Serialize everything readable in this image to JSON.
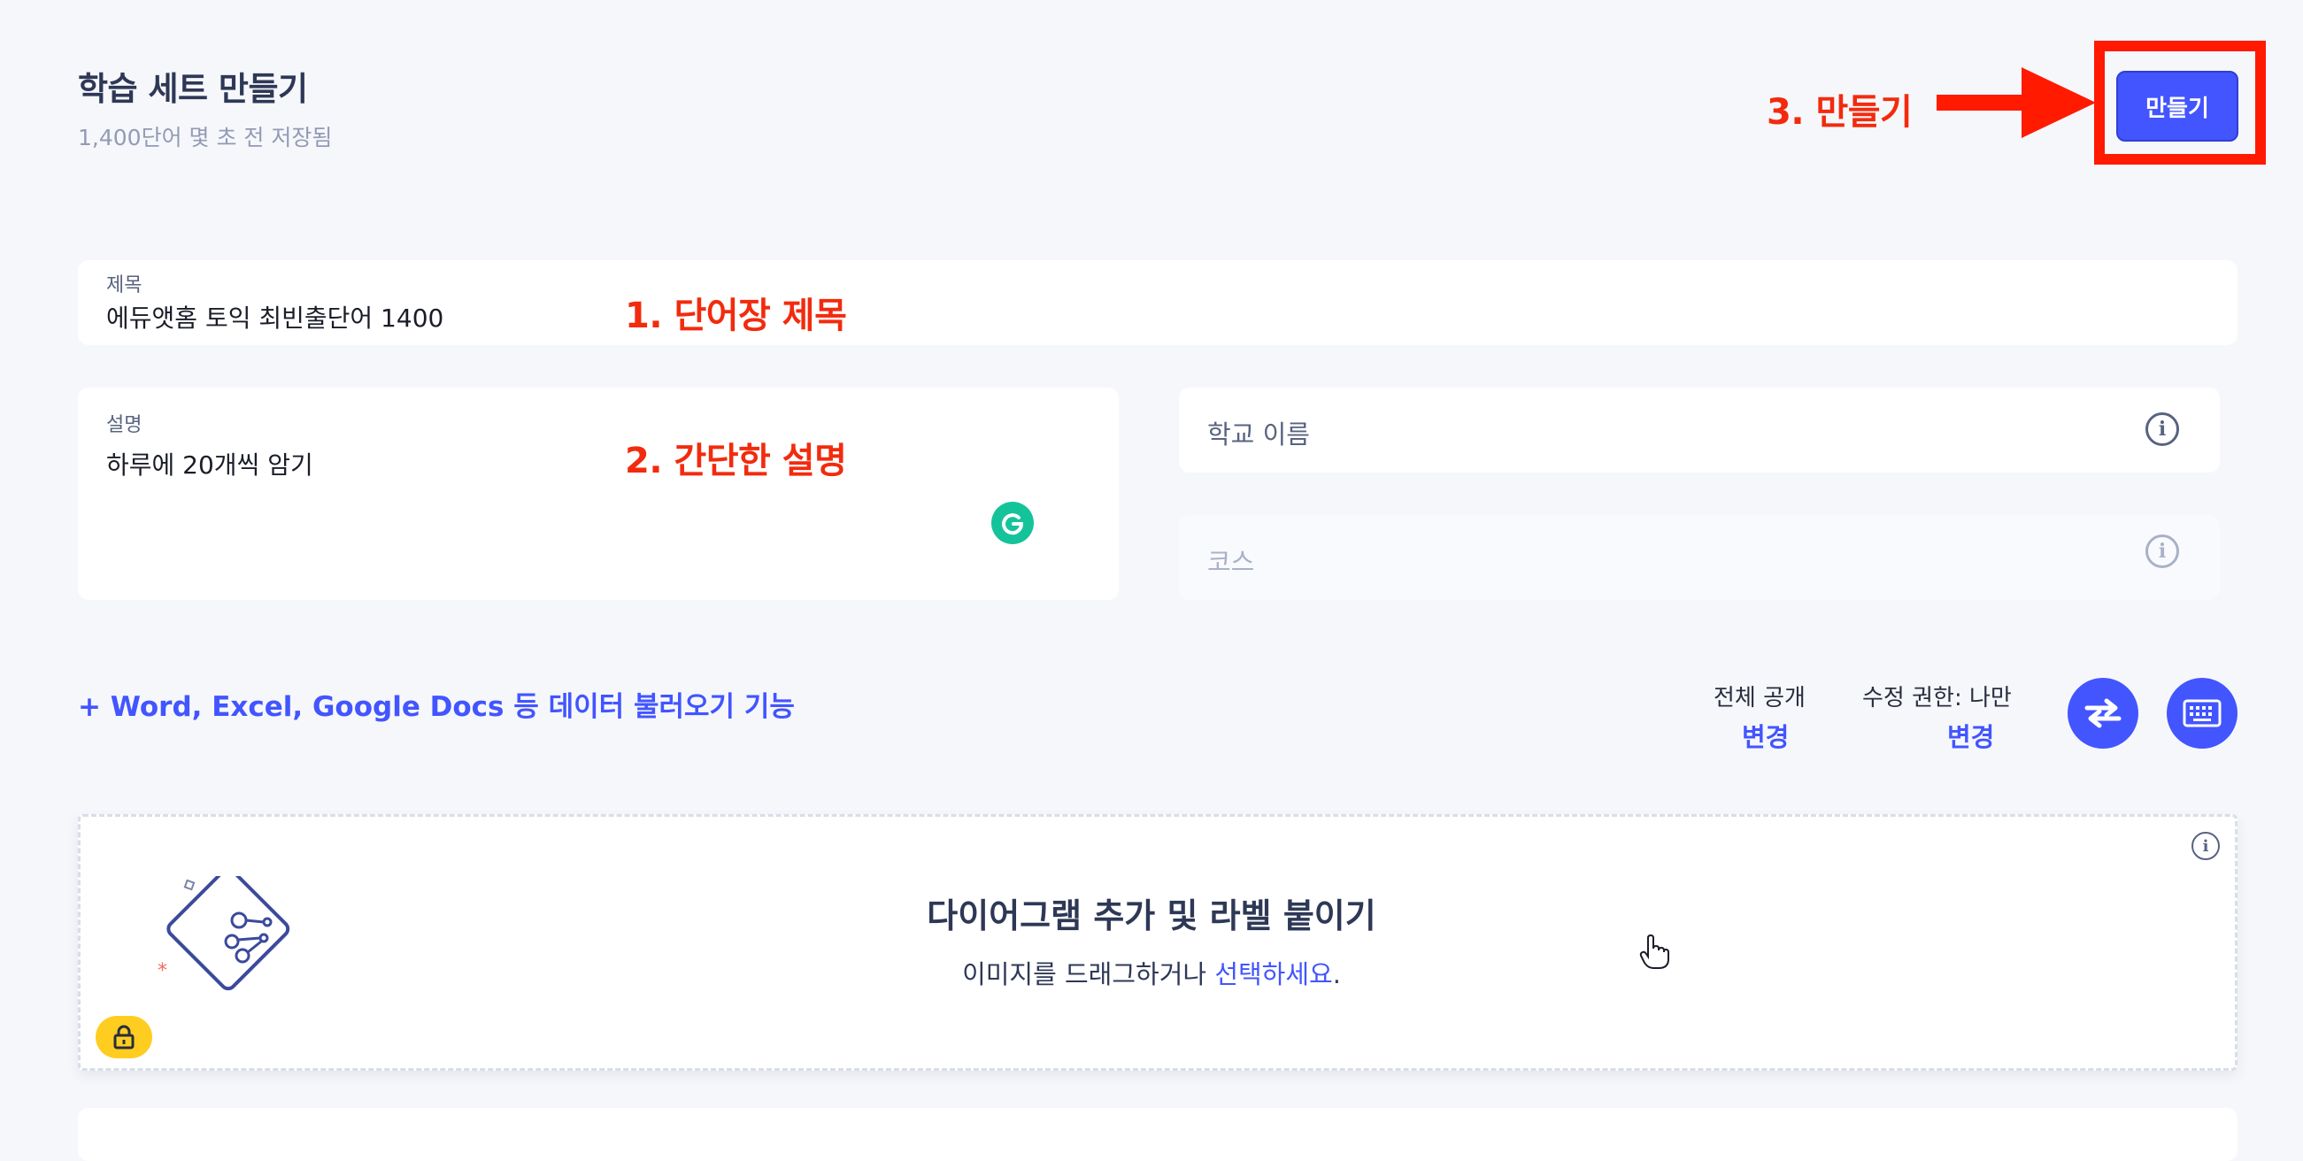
{
  "header": {
    "title": "학습 세트 만들기",
    "subtitle": "1,400단어 몇 초 전 저장됨",
    "create_label": "만들기"
  },
  "annotations": {
    "step1": "1. 단어장 제목",
    "step2": "2. 간단한 설명",
    "step3": "3. 만들기",
    "color": "#f22b0e"
  },
  "form": {
    "title_label": "제목",
    "title_value": "에듀앳홈 토익 최빈출단어 1400",
    "description_label": "설명",
    "description_value": "하루에 20개씩 암기",
    "school_placeholder": "학교 이름",
    "course_placeholder": "코스"
  },
  "import_link": "+ Word, Excel, Google Docs 등 데이터 불러오기 기능",
  "visibility": {
    "public_label": "전체 공개",
    "public_action": "변경",
    "edit_label": "수정 권한: 나만",
    "edit_action": "변경"
  },
  "icons": {
    "swap": "swap-arrows-icon",
    "keyboard": "keyboard-icon",
    "info": "info-icon",
    "lock": "lock-icon",
    "grammarly": "grammarly-icon",
    "diagram": "diagram-illustration-icon"
  },
  "diagram": {
    "title": "다이어그램 추가 및 라벨 붙이기",
    "subtitle_prefix": "이미지를 드래그하거나 ",
    "subtitle_link": "선택하세요",
    "subtitle_suffix": "."
  },
  "colors": {
    "accent": "#4255ff",
    "background": "#f6f7fb",
    "lock_badge": "#ffcd1f",
    "grammarly": "#15c39a"
  }
}
